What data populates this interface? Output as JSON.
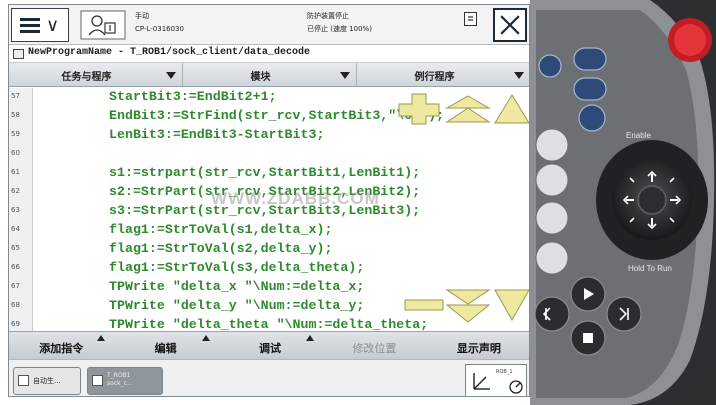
{
  "topbar": {
    "mode_label": "手动",
    "controller_id": "CP-L-0316030",
    "state_label": "防护装置停止",
    "speed_label": "已停止 (速度 100%)"
  },
  "breadcrumb": "NewProgramName - T_ROB1/sock_client/data_decode",
  "tabs": [
    {
      "label": "任务与程序"
    },
    {
      "label": "模块"
    },
    {
      "label": "例行程序"
    }
  ],
  "code_lines": [
    {
      "num": "57",
      "text": "StartBit3:=EndBit2+1;"
    },
    {
      "num": "58",
      "text": "EndBit3:=StrFind(str_rcv,StartBit3,\"\\0D\");"
    },
    {
      "num": "59",
      "text": "LenBit3:=EndBit3-StartBit3;"
    },
    {
      "num": "60",
      "text": ""
    },
    {
      "num": "61",
      "text": "s1:=strpart(str_rcv,StartBit1,LenBit1);"
    },
    {
      "num": "62",
      "text": "s2:=StrPart(str_rcv,StartBit2,LenBit2);"
    },
    {
      "num": "63",
      "text": "s3:=StrPart(str_rcv,StartBit3,LenBit3);"
    },
    {
      "num": "64",
      "text": "flag1:=StrToVal(s1,delta_x);"
    },
    {
      "num": "65",
      "text": "flag1:=StrToVal(s2,delta_y);"
    },
    {
      "num": "66",
      "text": "flag1:=StrToVal(s3,delta_theta);"
    },
    {
      "num": "67",
      "text": "TPWrite \"delta_x \"\\Num:=delta_x;"
    },
    {
      "num": "68",
      "text": "TPWrite \"delta_y \"\\Num:=delta_y;"
    },
    {
      "num": "69",
      "text": "TPWrite \"delta_theta \"\\Num:=delta_theta;"
    }
  ],
  "watermark": "WWW.ZDABB.COM",
  "bottom_buttons": [
    {
      "label": "添加指令",
      "enabled": true
    },
    {
      "label": "编辑",
      "enabled": true
    },
    {
      "label": "调试",
      "enabled": true
    },
    {
      "label": "修改位置",
      "enabled": false
    },
    {
      "label": "显示声明",
      "enabled": true
    }
  ],
  "taskbar": {
    "task1_label": "自动生...",
    "task2_label": "T_ROB1\nsock_c...",
    "quickset_label": "ROB_1"
  },
  "pendant": {
    "enable_label": "Enable",
    "hold_label": "Hold To Run"
  },
  "colors": {
    "code_green": "#2f8a2f",
    "scroll_yellow": "#ede9a0",
    "pendant_body": "#2c2e31",
    "emergency_red": "#d8262c"
  }
}
